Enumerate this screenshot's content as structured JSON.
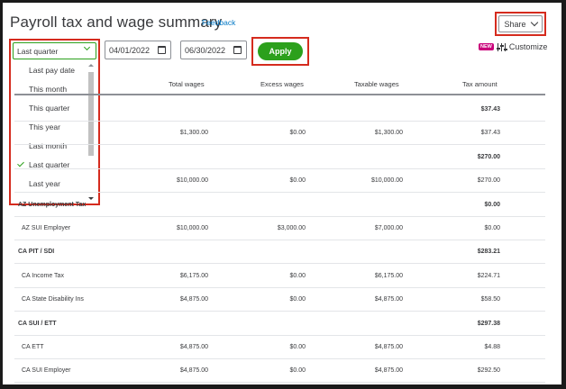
{
  "header": {
    "title": "Payroll tax and wage summary",
    "feedback": "Feedback",
    "share": "Share",
    "new_badge": "NEW",
    "customize": "Customize"
  },
  "filters": {
    "period_selected": "Last quarter",
    "period_options": [
      {
        "label": "Last pay date",
        "selected": false
      },
      {
        "label": "This month",
        "selected": false
      },
      {
        "label": "This quarter",
        "selected": false
      },
      {
        "label": "This year",
        "selected": false
      },
      {
        "label": "Last month",
        "selected": false
      },
      {
        "label": "Last quarter",
        "selected": true
      },
      {
        "label": "Last year",
        "selected": false
      }
    ],
    "start_date": "04/01/2022",
    "end_date": "06/30/2022",
    "apply": "Apply"
  },
  "table": {
    "columns": [
      "",
      "Total wages",
      "Excess wages",
      "Taxable wages",
      "Tax amount"
    ],
    "rows": [
      {
        "type": "group",
        "cells": [
          "",
          "",
          "",
          "",
          "$37.43"
        ]
      },
      {
        "type": "item",
        "cells": [
          "",
          "$1,300.00",
          "$0.00",
          "$1,300.00",
          "$37.43"
        ]
      },
      {
        "type": "group",
        "cells": [
          "",
          "",
          "",
          "",
          "$270.00"
        ]
      },
      {
        "type": "item",
        "cells": [
          "",
          "$10,000.00",
          "$0.00",
          "$10,000.00",
          "$270.00"
        ]
      },
      {
        "type": "group",
        "cells": [
          "AZ Unemployment Tax",
          "",
          "",
          "",
          "$0.00"
        ]
      },
      {
        "type": "item",
        "cells": [
          "AZ SUI Employer",
          "$10,000.00",
          "$3,000.00",
          "$7,000.00",
          "$0.00"
        ]
      },
      {
        "type": "group",
        "cells": [
          "CA PIT / SDI",
          "",
          "",
          "",
          "$283.21"
        ]
      },
      {
        "type": "item",
        "cells": [
          "CA Income Tax",
          "$6,175.00",
          "$0.00",
          "$6,175.00",
          "$224.71"
        ]
      },
      {
        "type": "item",
        "cells": [
          "CA State Disability Ins",
          "$4,875.00",
          "$0.00",
          "$4,875.00",
          "$58.50"
        ]
      },
      {
        "type": "group",
        "cells": [
          "CA SUI / ETT",
          "",
          "",
          "",
          "$297.38"
        ]
      },
      {
        "type": "item",
        "cells": [
          "CA ETT",
          "$4,875.00",
          "$0.00",
          "$4,875.00",
          "$4.88"
        ]
      },
      {
        "type": "item",
        "cells": [
          "CA SUI Employer",
          "$4,875.00",
          "$0.00",
          "$4,875.00",
          "$292.50"
        ]
      }
    ]
  }
}
